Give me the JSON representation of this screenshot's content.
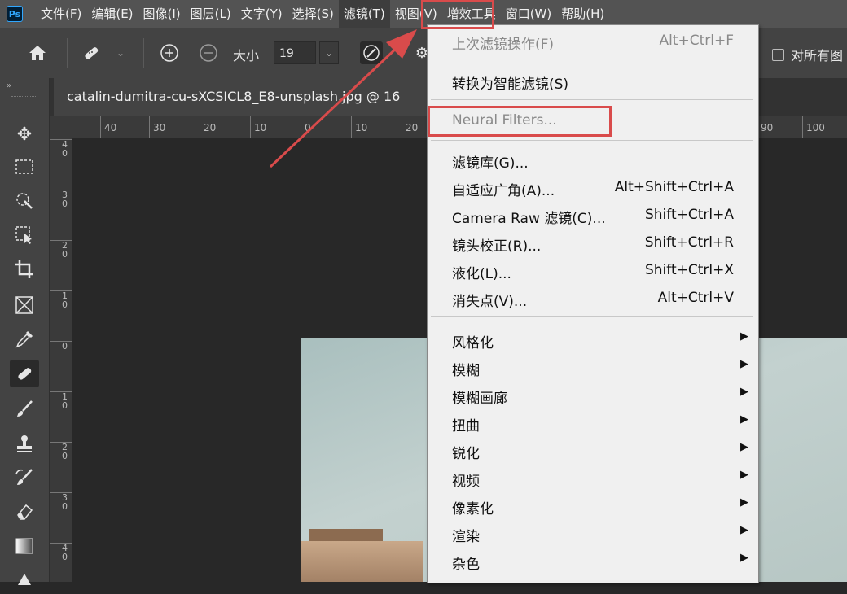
{
  "app": {
    "logo": "Ps"
  },
  "menubar": {
    "items": [
      "文件(F)",
      "编辑(E)",
      "图像(I)",
      "图层(L)",
      "文字(Y)",
      "选择(S)",
      "滤镜(T)",
      "视图(V)",
      "增效工具",
      "窗口(W)",
      "帮助(H)"
    ],
    "active": "滤镜(T)"
  },
  "options": {
    "size_label": "大小",
    "size_value": "19",
    "all_layers_label": "对所有图"
  },
  "document": {
    "tab_title": "catalin-dumitra-cu-sXCSICL8_E8-unsplash.jpg @ 16"
  },
  "ruler": {
    "h_ticks": [
      "40",
      "30",
      "20",
      "10",
      "0",
      "10",
      "20",
      "90",
      "100"
    ],
    "v_ticks": [
      "4\n0",
      "3\n0",
      "2\n0",
      "1\n0",
      "0",
      "1\n0",
      "2\n0",
      "3\n0",
      "4\n0"
    ]
  },
  "filter_menu": {
    "last_filter": {
      "label": "上次滤镜操作(F)",
      "shortcut": "Alt+Ctrl+F"
    },
    "smart_filter": {
      "label": "转换为智能滤镜(S)"
    },
    "neural_filters": {
      "label": "Neural Filters..."
    },
    "items": [
      {
        "label": "滤镜库(G)...",
        "shortcut": ""
      },
      {
        "label": "自适应广角(A)...",
        "shortcut": "Alt+Shift+Ctrl+A"
      },
      {
        "label": "Camera Raw 滤镜(C)...",
        "shortcut": "Shift+Ctrl+A"
      },
      {
        "label": "镜头校正(R)...",
        "shortcut": "Shift+Ctrl+R"
      },
      {
        "label": "液化(L)...",
        "shortcut": "Shift+Ctrl+X"
      },
      {
        "label": "消失点(V)...",
        "shortcut": "Alt+Ctrl+V"
      }
    ],
    "submenus": [
      "风格化",
      "模糊",
      "模糊画廊",
      "扭曲",
      "锐化",
      "视频",
      "像素化",
      "渲染",
      "杂色"
    ]
  },
  "icons": {
    "home": "home-icon",
    "brush": "healing-brush-icon",
    "add": "add-circle-icon",
    "subtract": "subtract-circle-icon",
    "arrow": "red-arrow-annotation"
  },
  "colors": {
    "highlight": "#d94b4b",
    "menubar": "#535353"
  }
}
